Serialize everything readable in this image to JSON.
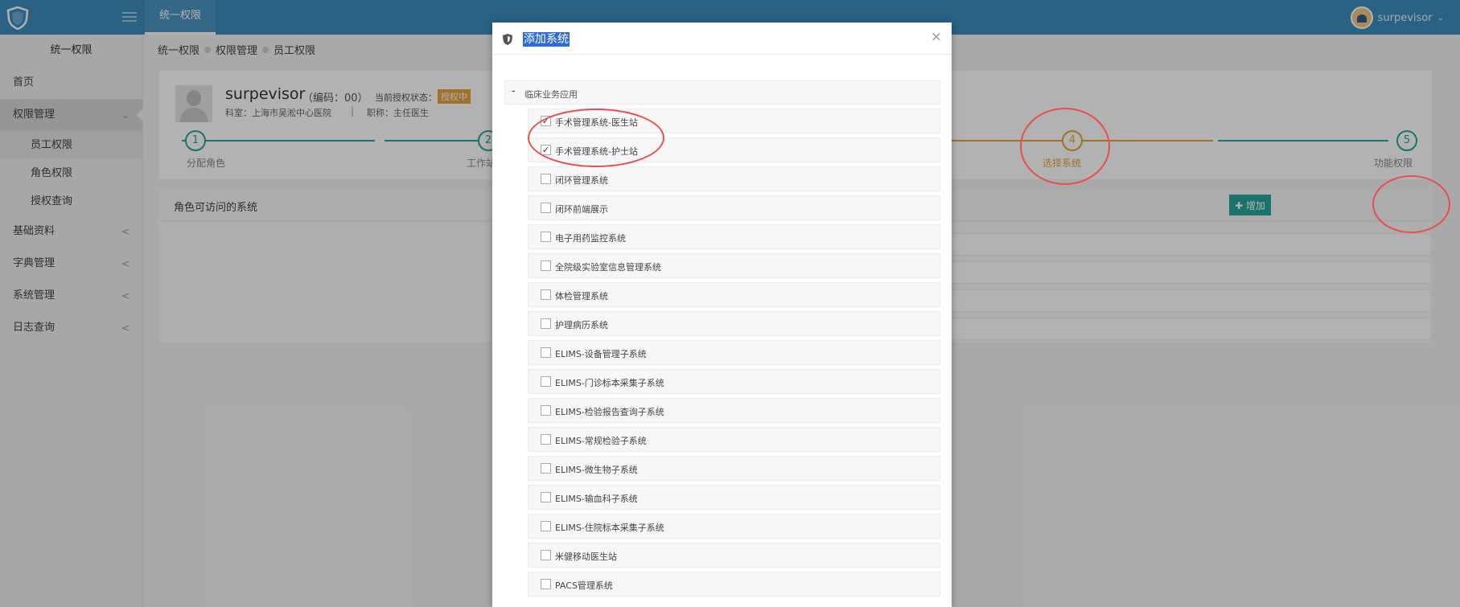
{
  "topbar": {
    "app_tab": "统一权限",
    "username": "surpevisor",
    "user_caret": "⌄"
  },
  "sidebar": {
    "title": "统一权限",
    "items": [
      {
        "label": "首页",
        "chev": ""
      },
      {
        "label": "权限管理",
        "chev": "⌄"
      },
      {
        "label": "基础资料",
        "chev": "<"
      },
      {
        "label": "字典管理",
        "chev": "<"
      },
      {
        "label": "系统管理",
        "chev": "<"
      },
      {
        "label": "日志查询",
        "chev": "<"
      }
    ],
    "subitems": [
      "员工权限",
      "角色权限",
      "授权查询"
    ]
  },
  "breadcrumb": [
    "统一权限",
    "权限管理",
    "员工权限"
  ],
  "profile": {
    "name": "surpevisor",
    "code": "（编码：00）",
    "status_label": "当前授权状态：",
    "status": "授权中",
    "dept": "科室：上海市吴淞中心医院",
    "sep": "|",
    "title": "职称：主任医生"
  },
  "steps": [
    {
      "num": "1",
      "label": "分配角色"
    },
    {
      "num": "2",
      "label": "工作站"
    },
    {
      "num": "4",
      "label": "选择系统"
    },
    {
      "num": "5",
      "label": "功能权限"
    }
  ],
  "role_panel": {
    "title": "角色可访问的系统",
    "add_label": "✚ 增加"
  },
  "modal": {
    "title": "添加系统",
    "close": "×",
    "group": {
      "toggle": "-",
      "label": "临床业务应用"
    },
    "systems": [
      {
        "label": "手术管理系统-医生站",
        "checked": "✓"
      },
      {
        "label": "手术管理系统-护士站",
        "checked": "✓"
      },
      {
        "label": "闭环管理系统",
        "checked": ""
      },
      {
        "label": "闭环前端展示",
        "checked": ""
      },
      {
        "label": "电子用药监控系统",
        "checked": ""
      },
      {
        "label": "全院级实验室信息管理系统",
        "checked": ""
      },
      {
        "label": "体检管理系统",
        "checked": ""
      },
      {
        "label": "护理病历系统",
        "checked": ""
      },
      {
        "label": "ELIMS-设备管理子系统",
        "checked": ""
      },
      {
        "label": "ELIMS-门诊标本采集子系统",
        "checked": ""
      },
      {
        "label": "ELIMS-检验报告查询子系统",
        "checked": ""
      },
      {
        "label": "ELIMS-常规检验子系统",
        "checked": ""
      },
      {
        "label": "ELIMS-微生物子系统",
        "checked": ""
      },
      {
        "label": "ELIMS-输血科子系统",
        "checked": ""
      },
      {
        "label": "ELIMS-住院标本采集子系统",
        "checked": ""
      },
      {
        "label": "米健移动医生站",
        "checked": ""
      },
      {
        "label": "PACS管理系统",
        "checked": ""
      }
    ]
  },
  "colors": {
    "topbar": "#3c8dbc",
    "teal": "#26a69a",
    "orange": "#e6a23c",
    "annotation": "#e84e4e"
  }
}
